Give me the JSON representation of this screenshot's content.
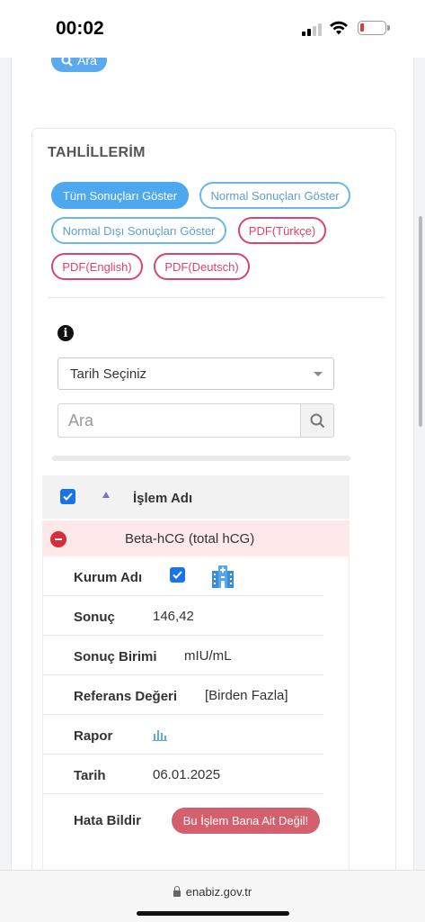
{
  "status_bar": {
    "time": "00:02",
    "signal_bars": 4,
    "signal_active": 2,
    "battery_level": 0.1
  },
  "top": {
    "search_button_label": "Ara"
  },
  "card": {
    "title": "TAHLİLLERİM",
    "filters": [
      {
        "label": "Tüm Sonuçları Göster",
        "active": true
      },
      {
        "label": "Normal Sonuçları Göster",
        "active": false
      },
      {
        "label": "Normal Dışı Sonuçları Göster",
        "active": false
      },
      {
        "label": "PDF(Türkçe)",
        "active": false
      },
      {
        "label": "PDF(English)",
        "active": false
      },
      {
        "label": "PDF(Deutsch)",
        "active": false
      }
    ],
    "date_select": {
      "value": "Tarih Seçiniz"
    },
    "search": {
      "placeholder": "Ara"
    },
    "table": {
      "header": "İşlem Adı",
      "row_name": "Beta-hCG (total hCG)",
      "details": {
        "institution_label": "Kurum Adı",
        "result_label": "Sonuç",
        "result_value": "146,42",
        "unit_label": "Sonuç Birimi",
        "unit_value": "mIU/mL",
        "reference_label": "Referans Değeri",
        "reference_value": "[Birden Fazla]",
        "report_label": "Rapor",
        "date_label": "Tarih",
        "date_value": "06.01.2025",
        "report_error_label": "Hata Bildir",
        "report_error_button": "Bu İşlem Bana Ait Değil!"
      }
    }
  },
  "browser": {
    "url": "enabiz.gov.tr"
  },
  "colors": {
    "accent_blue": "#4da8f0",
    "pdf_red": "#d9456e",
    "error_button": "#d4606e",
    "row_highlight": "#fde8ea"
  }
}
